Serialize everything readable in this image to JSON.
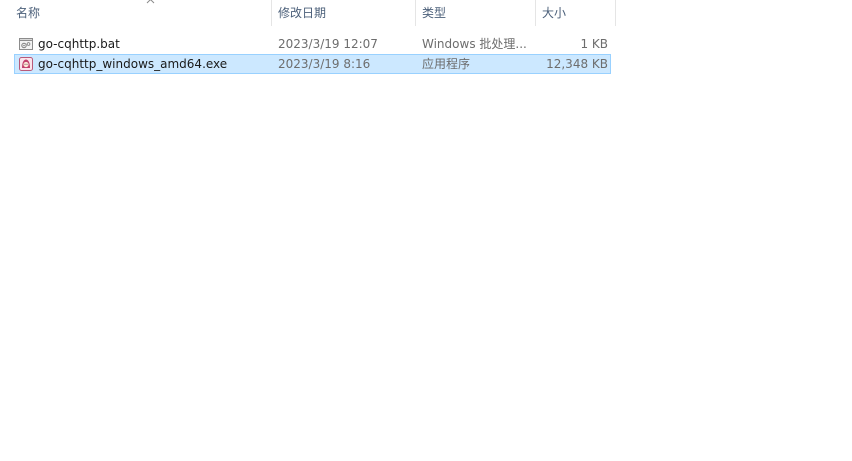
{
  "columns": {
    "name": "名称",
    "date": "修改日期",
    "type": "类型",
    "size": "大小"
  },
  "files": [
    {
      "name": "go-cqhttp.bat",
      "date": "2023/3/19 12:07",
      "type": "Windows 批处理...",
      "size": "1 KB",
      "icon": "batch-file-icon",
      "selected": false
    },
    {
      "name": "go-cqhttp_windows_amd64.exe",
      "date": "2023/3/19 8:16",
      "type": "应用程序",
      "size": "12,348 KB",
      "icon": "app-exe-icon",
      "selected": true
    }
  ],
  "colors": {
    "selection_bg": "#cce8ff",
    "selection_border": "#99d1ff",
    "header_text": "#4c607a"
  }
}
